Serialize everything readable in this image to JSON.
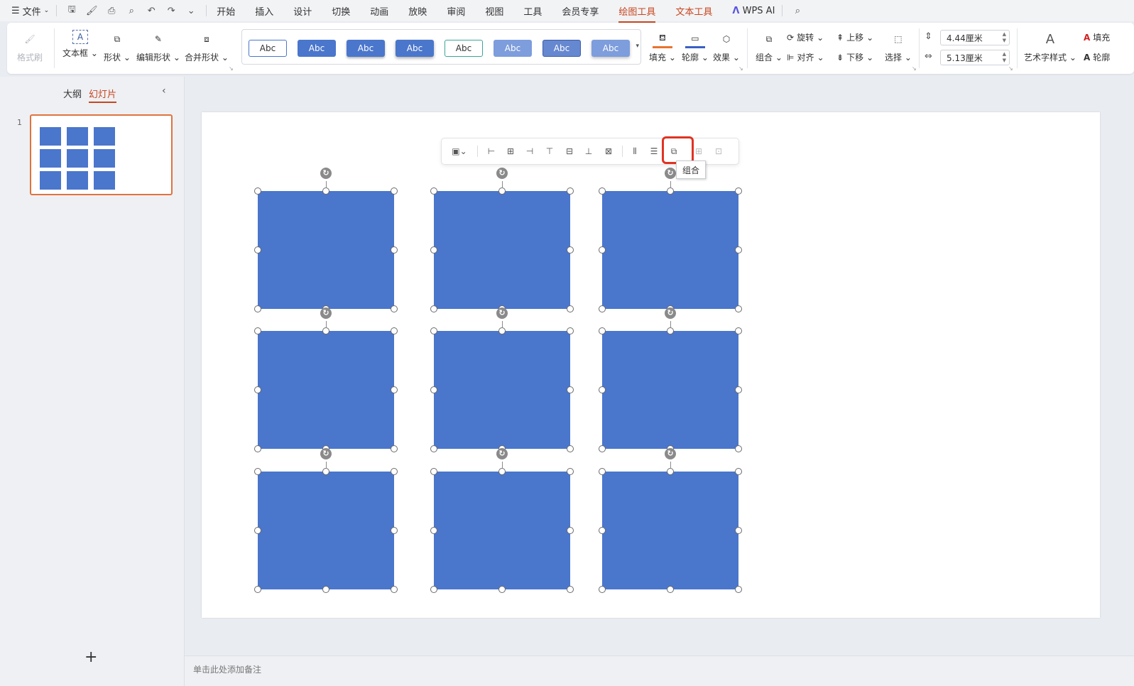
{
  "menubar": {
    "file_label": "文件",
    "tabs": [
      "开始",
      "插入",
      "设计",
      "切换",
      "动画",
      "放映",
      "审阅",
      "视图",
      "工具",
      "会员专享",
      "绘图工具",
      "文本工具",
      "WPS AI"
    ],
    "active_tab": "绘图工具"
  },
  "ribbon": {
    "format_painter": "格式刷",
    "text_box": "文本框",
    "shape": "形状",
    "edit_shape": "编辑形状",
    "merge_shape": "合并形状",
    "style_gallery": [
      "Abc",
      "Abc",
      "Abc",
      "Abc",
      "Abc",
      "Abc",
      "Abc",
      "Abc"
    ],
    "fill": "填充",
    "outline": "轮廓",
    "effect": "效果",
    "group": "组合",
    "rotate": "旋转",
    "align": "对齐",
    "bring_forward": "上移",
    "send_backward": "下移",
    "select": "选择",
    "height_value": "4.44厘米",
    "width_value": "5.13厘米",
    "art_text_style": "艺术字样式",
    "text_fill": "填充",
    "text_outline": "轮廓"
  },
  "leftpanel": {
    "tab_outline": "大纲",
    "tab_slides": "幻灯片",
    "slide_number": "1",
    "add_slide": "+"
  },
  "float_toolbar": {
    "tooltip": "组合"
  },
  "notes": {
    "placeholder": "单击此处添加备注"
  },
  "colors": {
    "shape_fill": "#4a76cc",
    "accent": "#c7461f",
    "highlight": "#e03323"
  }
}
